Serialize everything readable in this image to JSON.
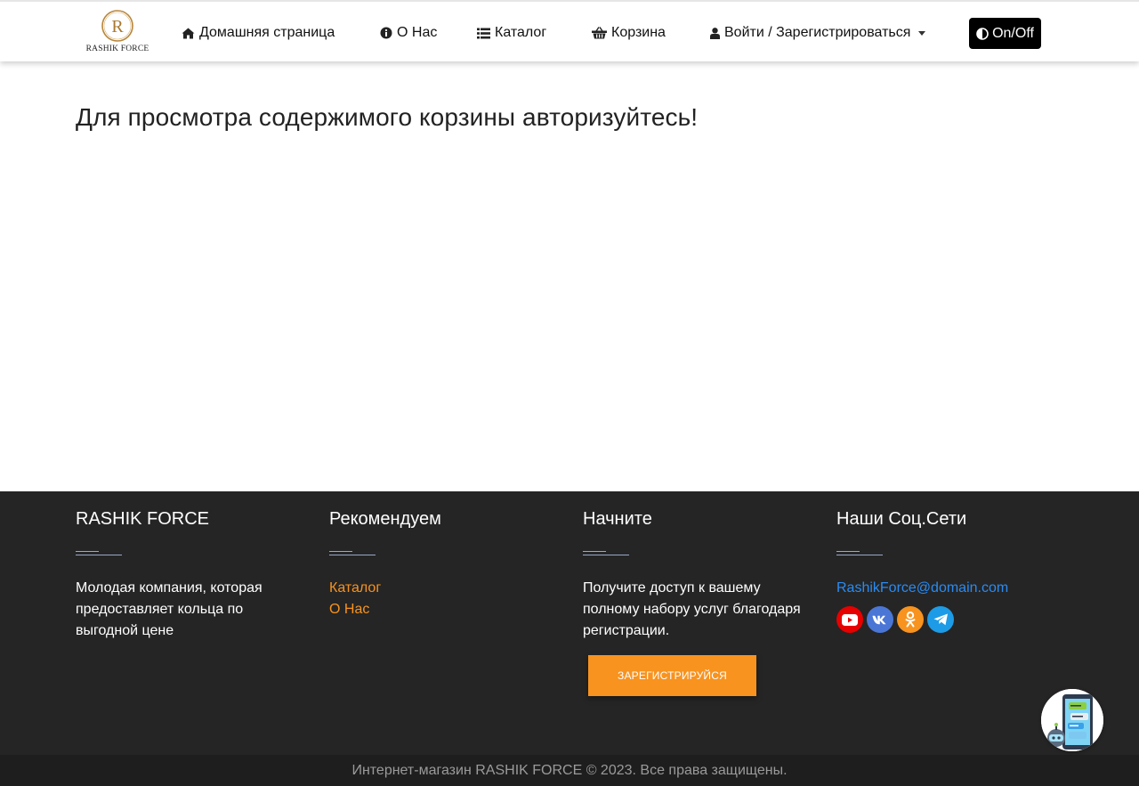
{
  "brand": {
    "logo_letter": "R",
    "logo_text": "RASHIK FORCE"
  },
  "nav": {
    "home": "Домашняя страница",
    "about": "О Нас",
    "catalog": "Каталог",
    "cart": "Корзина",
    "login": "Войти / Зарегистрироваться",
    "toggle": "On/Off"
  },
  "main": {
    "title": "Для просмотра содержимого корзины авторизуйтесь!"
  },
  "footer": {
    "col1": {
      "title": "RASHIK FORCE",
      "text": "Молодая компания, которая предоставляет кольца по выгодной цене"
    },
    "col2": {
      "title": "Рекомендуем",
      "links": [
        "Каталог",
        "О Нас"
      ]
    },
    "col3": {
      "title": "Начните",
      "text": "Получите доступ к вашему полному набору услуг благодаря регистрации.",
      "button": "ЗАРЕГИСТРИРУЙСЯ"
    },
    "col4": {
      "title": "Наши Соц.Сети",
      "email": "RashikForce@domain.com",
      "socials": [
        {
          "name": "youtube",
          "icon": "youtube-icon",
          "color": "#e60000"
        },
        {
          "name": "vk",
          "icon": "vk-icon",
          "color": "#4a76d6"
        },
        {
          "name": "odnoklassniki",
          "icon": "odnoklassniki-icon",
          "color": "#f7931e"
        },
        {
          "name": "telegram",
          "icon": "telegram-icon",
          "color": "#1d9be6"
        }
      ]
    },
    "copyright": "Интернет-магазин RASHIK FORCE © 2023. Все права защищены."
  },
  "colors": {
    "accent": "#f8931f",
    "footer_bg": "#252525",
    "link_blue": "#2a8bf2",
    "logo_gold": "#b8863b"
  }
}
